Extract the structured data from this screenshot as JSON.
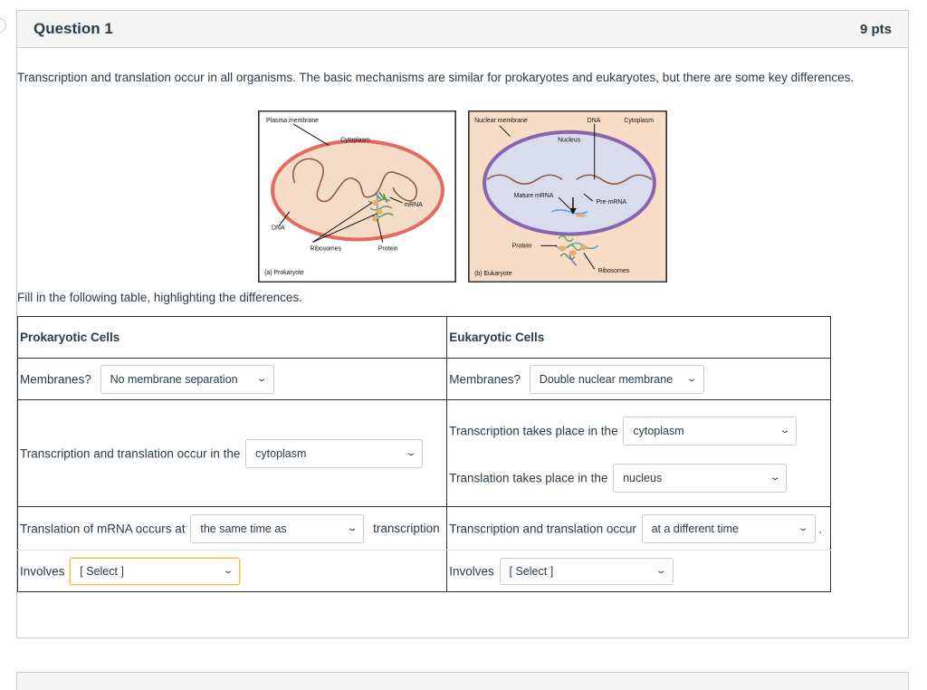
{
  "question": {
    "title": "Question 1",
    "points": "9 pts",
    "intro": "Transcription and translation occur in all organisms.  The basic mechanisms are similar for prokaryotes and eukaryotes, but there are some key differences.",
    "fill_prompt": "Fill in the following table, highlighting the differences."
  },
  "figure_a": {
    "plasma_membrane": "Plasma membrane",
    "cytoplasm": "Cytoplasm",
    "mrna": "mRNA",
    "dna": "DNA",
    "ribosomes": "Ribosomes",
    "protein": "Protein",
    "caption": "(a) Prokaryote"
  },
  "figure_b": {
    "nuclear_membrane": "Nuclear membrane",
    "dna": "DNA",
    "cytoplasm": "Cytoplasm",
    "nucleus": "Nucleus",
    "mature_mrna": "Mature mRNA",
    "pre_mrna": "Pre-mRNA",
    "protein": "Protein",
    "ribosomes": "Ribosomes",
    "caption": "(b) Eukaryote"
  },
  "table": {
    "prok_header": "Prokaryotic Cells",
    "euk_header": "Eukaryotic Cells",
    "membranes_label": "Membranes?",
    "prok_membranes": "No membrane separation",
    "euk_membranes": "Double nuclear membrane",
    "prok_location_label": "Transcription and translation occur in the",
    "prok_location": "cytoplasm",
    "euk_transcription_label": "Transcription takes place in the",
    "euk_transcription": "cytoplasm",
    "euk_translation_label": "Translation takes place in the",
    "euk_translation": "nucleus",
    "prok_timing_label": "Translation of mRNA occurs at",
    "prok_timing": "the same time as",
    "prok_timing_suffix": "transcription",
    "euk_timing_label": "Transcription and translation occur",
    "euk_timing": "at a different time",
    "euk_timing_suffix": ".",
    "involves_label": "Involves",
    "prok_involves": "[ Select ]",
    "euk_involves": "[ Select ]"
  },
  "colors": {
    "cell_fill": "#f5dcc8",
    "membrane": "#e46b5f",
    "nucleus_fill": "#d9dced",
    "nuclear_membrane": "#8a64b0",
    "dna": "#8c5a4a",
    "select_highlight": "#f0c040"
  },
  "icons": {
    "select_arrow": "chevron-down-icon"
  }
}
